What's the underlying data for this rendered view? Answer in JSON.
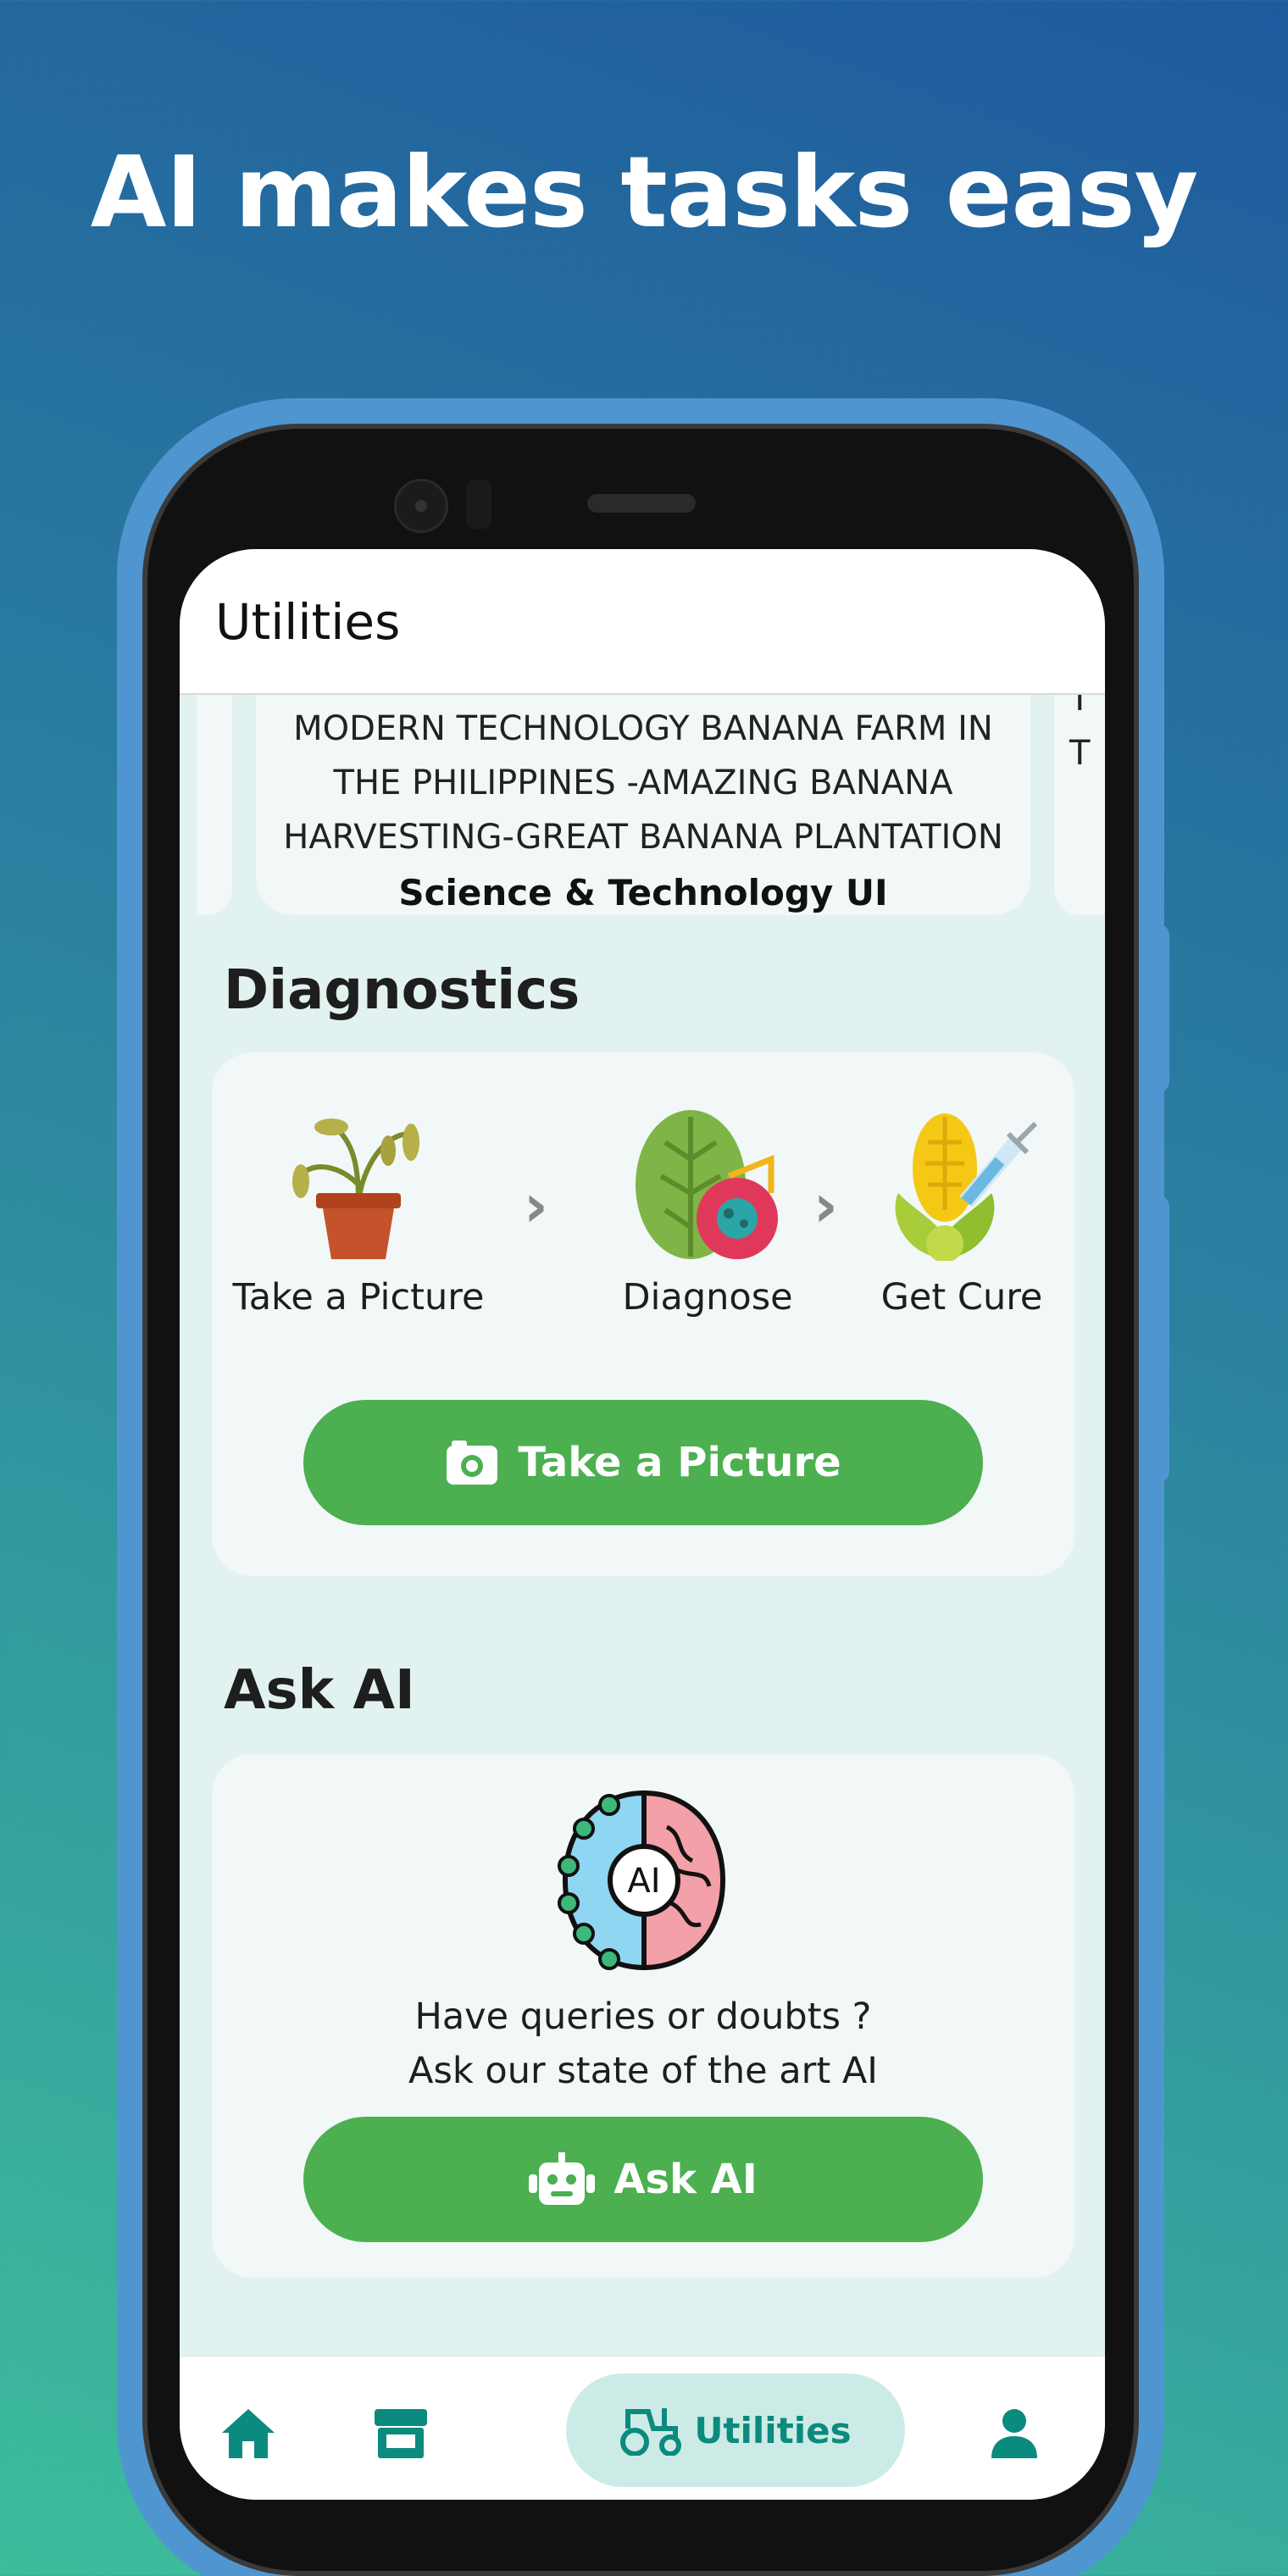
{
  "headline": "AI makes tasks easy",
  "colors": {
    "accent": "#4caf50",
    "nav_active": "#0b8a7e",
    "screen_bg": "#e2f2f0"
  },
  "appbar": {
    "title": "Utilities"
  },
  "news": {
    "lines": [
      "MODERN TECHNOLOGY BANANA FARM IN",
      "THE PHILIPPINES -AMAZING BANANA",
      "HARVESTING-GREAT BANANA PLANTATION"
    ],
    "source": "Science & Technology UI",
    "peek_lines": [
      "T",
      "T"
    ]
  },
  "diagnostics": {
    "title": "Diagnostics",
    "steps": [
      {
        "label": "Take a Picture",
        "icon": "wilted-plant-icon"
      },
      {
        "label": "Diagnose",
        "icon": "leaf-virus-icon"
      },
      {
        "label": "Get Cure",
        "icon": "corn-syringe-icon"
      }
    ],
    "button_label": "Take a Picture",
    "button_icon": "camera-icon"
  },
  "ask_ai": {
    "title": "Ask AI",
    "icon": "ai-brain-icon",
    "icon_text": "AI",
    "line1": "Have queries or doubts ?",
    "line2": "Ask our state of the art AI",
    "button_label": "Ask AI",
    "button_icon": "robot-icon"
  },
  "bottom_nav": {
    "items": [
      {
        "name": "home",
        "icon": "home-icon"
      },
      {
        "name": "store",
        "icon": "store-icon"
      },
      {
        "name": "utilities",
        "icon": "tractor-icon",
        "label": "Utilities",
        "active": true
      },
      {
        "name": "profile",
        "icon": "person-icon"
      }
    ]
  }
}
